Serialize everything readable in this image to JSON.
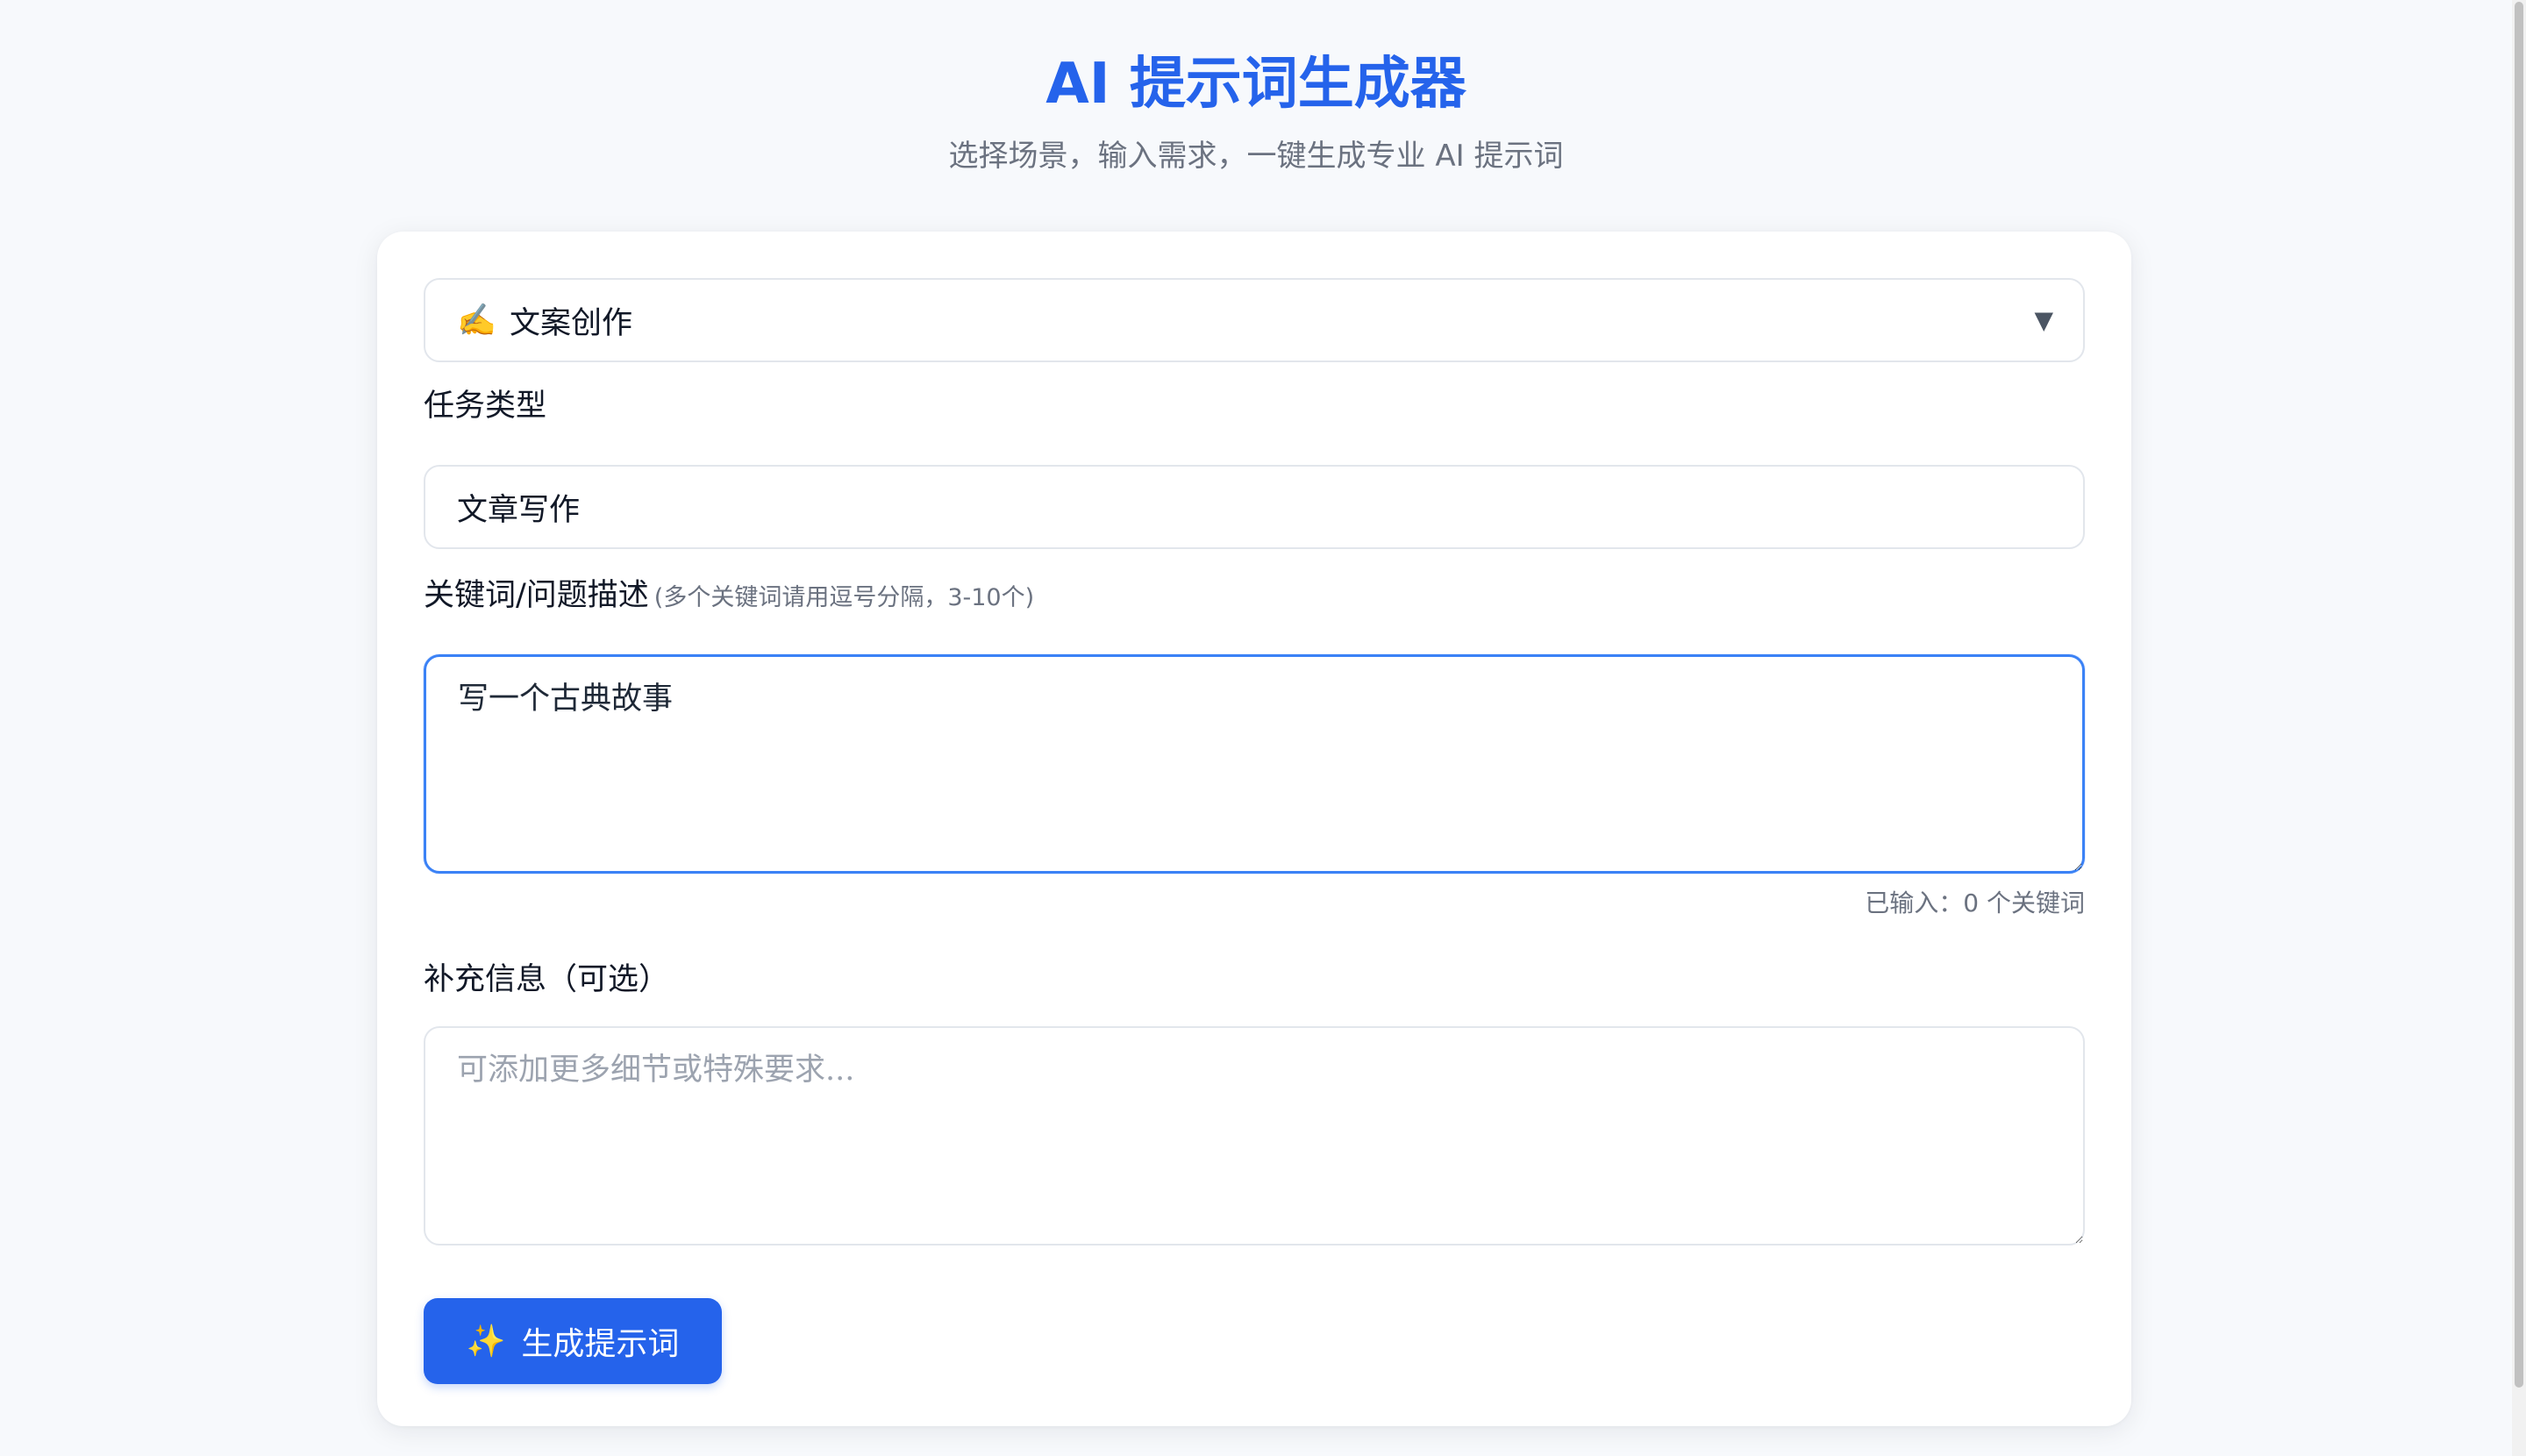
{
  "header": {
    "title": "AI 提示词生成器",
    "subtitle": "选择场景，输入需求，一键生成专业 AI 提示词"
  },
  "scene": {
    "icon": "writing-hand-icon",
    "emoji": "✍️",
    "selected": "文案创作",
    "arrow": "▼"
  },
  "task_type": {
    "label": "任务类型",
    "value": "文章写作"
  },
  "keywords": {
    "label": "关键词/问题描述",
    "hint": "(多个关键词请用逗号分隔，3-10个)",
    "value": "写一个古典故事",
    "counter": "已输入：0 个关键词"
  },
  "extra": {
    "label": "补充信息（可选）",
    "placeholder": "可添加更多细节或特殊要求..."
  },
  "actions": {
    "generate_icon": "sparkle-icon",
    "generate_glyph": "✨",
    "generate_label": "生成提示词"
  },
  "colors": {
    "accent": "#2563eb",
    "background": "#f7f9fc",
    "focus_border": "#3b82f6"
  }
}
